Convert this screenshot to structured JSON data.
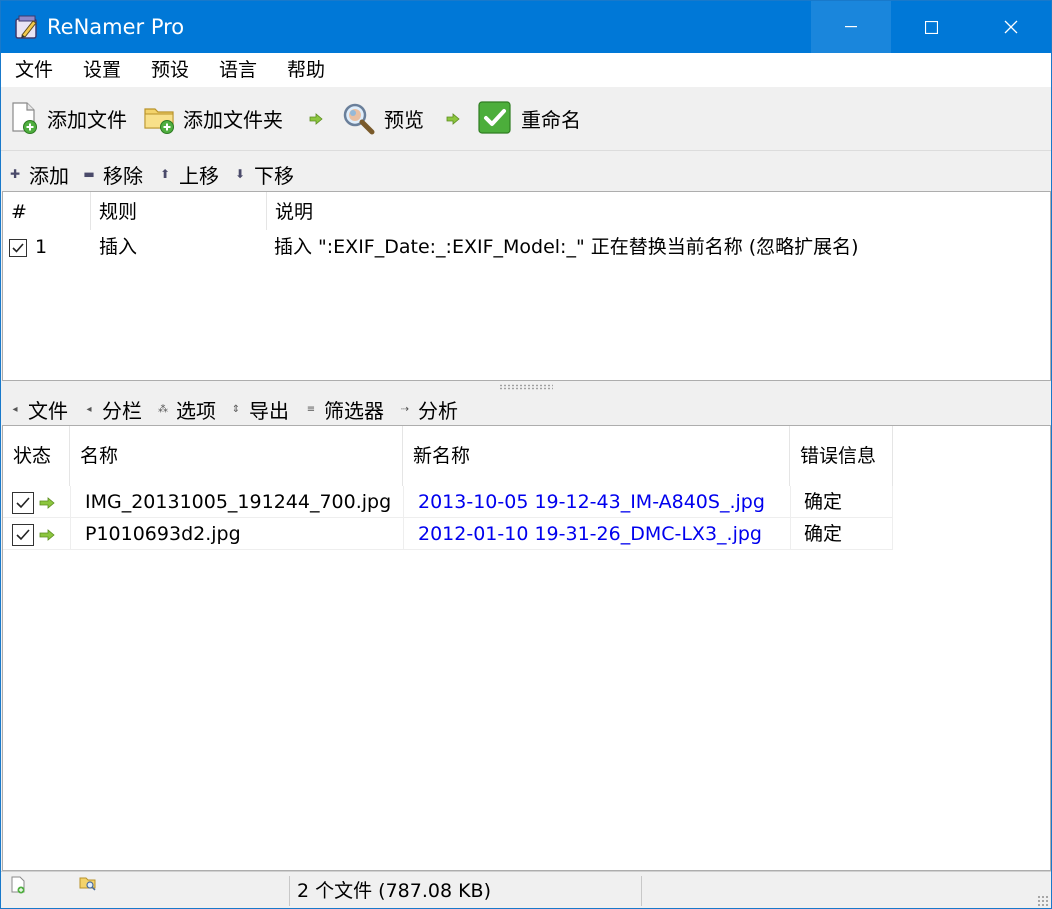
{
  "window": {
    "title": "ReNamer Pro",
    "controls": {
      "minimize": "—",
      "maximize": "☐",
      "close": "✕"
    }
  },
  "menu": [
    "文件",
    "设置",
    "预设",
    "语言",
    "帮助"
  ],
  "toolbar": {
    "add_files": "添加文件",
    "add_folder": "添加文件夹",
    "preview": "预览",
    "rename": "重命名"
  },
  "rules_toolbar": {
    "add": "添加",
    "remove": "移除",
    "up": "上移",
    "down": "下移"
  },
  "rules_table": {
    "columns": [
      "#",
      "规则",
      "说明"
    ],
    "rows": [
      {
        "checked": true,
        "num": "1",
        "rule": "插入",
        "description": "插入 \":EXIF_Date:_:EXIF_Model:_\" 正在替换当前名称 (忽略扩展名)"
      }
    ]
  },
  "files_toolbar": {
    "files": "文件",
    "columns": "分栏",
    "options": "选项",
    "export": "导出",
    "filters": "筛选器",
    "analyze": "分析"
  },
  "files_table": {
    "columns": [
      "状态",
      "名称",
      "新名称",
      "错误信息"
    ],
    "rows": [
      {
        "checked": true,
        "name": "IMG_20131005_191244_700.jpg",
        "new_name": "2013-10-05 19-12-43_IM-A840S_.jpg",
        "error": "确定"
      },
      {
        "checked": true,
        "name": "P1010693d2.jpg",
        "new_name": "2012-01-10 19-31-26_DMC-LX3_.jpg",
        "error": "确定"
      }
    ]
  },
  "statusbar": {
    "summary": "2 个文件 (787.08 KB)"
  },
  "colors": {
    "titlebar": "#0078d7",
    "new_name_link": "#0000ee",
    "arrow_green": "#7dbb1e"
  }
}
